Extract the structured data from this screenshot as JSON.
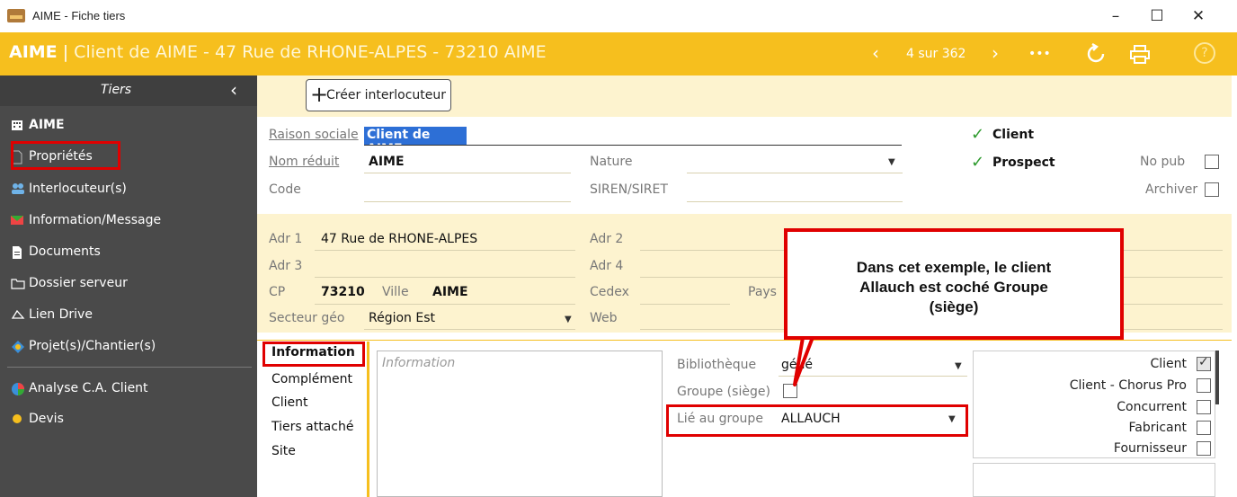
{
  "window": {
    "title": "AIME - Fiche tiers",
    "minimize": "–",
    "maximize": "☐",
    "close": "✕"
  },
  "header": {
    "name": "AIME",
    "separator": "|",
    "subtitle": "Client de AIME - 47 Rue de RHONE-ALPES - 73210 AIME",
    "prev": "‹",
    "count": "4 sur 362",
    "next": "›",
    "more": "•••",
    "refresh_icon": "refresh-icon",
    "print_icon": "print-icon",
    "help": "?"
  },
  "sidebar": {
    "title": "Tiers",
    "collapse": "‹",
    "items": [
      {
        "label": "AIME",
        "icon": "building-icon"
      },
      {
        "label": "Propriétés",
        "icon": "document-icon"
      },
      {
        "label": "Interlocuteur(s)",
        "icon": "users-icon"
      },
      {
        "label": "Information/Message",
        "icon": "message-flag-icon"
      },
      {
        "label": "Documents",
        "icon": "file-icon"
      },
      {
        "label": "Dossier serveur",
        "icon": "folder-icon"
      },
      {
        "label": "Lien Drive",
        "icon": "cloud-icon"
      },
      {
        "label": "Projet(s)/Chantier(s)",
        "icon": "project-icon"
      },
      {
        "label": "Analyse C.A. Client",
        "icon": "chart-icon"
      },
      {
        "label": "Devis",
        "icon": "dot-icon"
      }
    ]
  },
  "toolbar": {
    "create_contact": "Créer interlocuteur"
  },
  "identity": {
    "raison_sociale_label": "Raison sociale",
    "raison_sociale_value": "Client de AIME",
    "nom_reduit_label": "Nom réduit",
    "nom_reduit_value": "AIME",
    "code_label": "Code",
    "nature_label": "Nature",
    "siren_label": "SIREN/SIRET",
    "client_label": "Client",
    "prospect_label": "Prospect",
    "nopub_label": "No pub",
    "archiver_label": "Archiver"
  },
  "address": {
    "adr1_label": "Adr 1",
    "adr1_value": "47 Rue de RHONE-ALPES",
    "adr2_label": "Adr 2",
    "adr3_label": "Adr 3",
    "adr4_label": "Adr 4",
    "cp_label": "CP",
    "cp_value": "73210",
    "ville_label": "Ville",
    "ville_value": "AIME",
    "cedex_label": "Cedex",
    "pays_label": "Pays",
    "secteur_label": "Secteur géo",
    "secteur_value": "Région Est",
    "web_label": "Web"
  },
  "tabs": [
    "Information",
    "Complément",
    "Client",
    "Tiers attaché",
    "Site"
  ],
  "info": {
    "placeholder": "Information",
    "bibliotheque_label": "Bibliothèque",
    "bibliotheque_value": "géné",
    "groupe_label": "Groupe (siège)",
    "lie_label": "Lié au groupe",
    "lie_value": "ALLAUCH"
  },
  "categories": [
    {
      "label": "Client",
      "checked": true
    },
    {
      "label": "Client - Chorus Pro",
      "checked": false
    },
    {
      "label": "Concurrent",
      "checked": false
    },
    {
      "label": "Fabricant",
      "checked": false
    },
    {
      "label": "Fournisseur",
      "checked": false
    }
  ],
  "callout": {
    "text_1": "Dans cet exemple, le client",
    "text_2": "Allauch est coché Groupe",
    "text_3": "(siège)"
  },
  "colors": {
    "accent": "#f6bf1e",
    "sidebar": "#4a4a4a",
    "highlight": "#e00000",
    "check": "#2e9b2e"
  }
}
